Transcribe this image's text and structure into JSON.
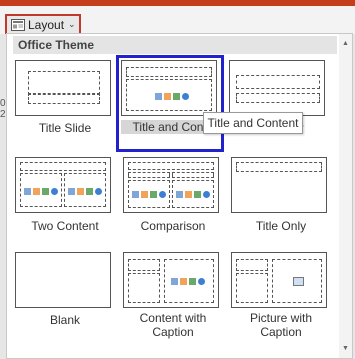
{
  "ribbon": {
    "layout_label": "Layout",
    "layout_icon": "slide-layout-icon",
    "chevron": "⌄",
    "accent_color": "#c43e1c"
  },
  "gallery": {
    "header": "Office Theme",
    "items": [
      {
        "label": "Title Slide"
      },
      {
        "label": "Title and Conte",
        "selected": true
      },
      {
        "label": "der"
      },
      {
        "label": "Two Content"
      },
      {
        "label": "Comparison"
      },
      {
        "label": "Title Only"
      },
      {
        "label": "Blank"
      },
      {
        "label_line1": "Content with",
        "label_line2": "Caption"
      },
      {
        "label_line1": "Picture with",
        "label_line2": "Caption"
      }
    ],
    "selection_color": "#2222cc"
  },
  "tooltip": {
    "text": "Title and Content"
  },
  "left_fragments": {
    "f1": "0",
    "f2": "2"
  }
}
